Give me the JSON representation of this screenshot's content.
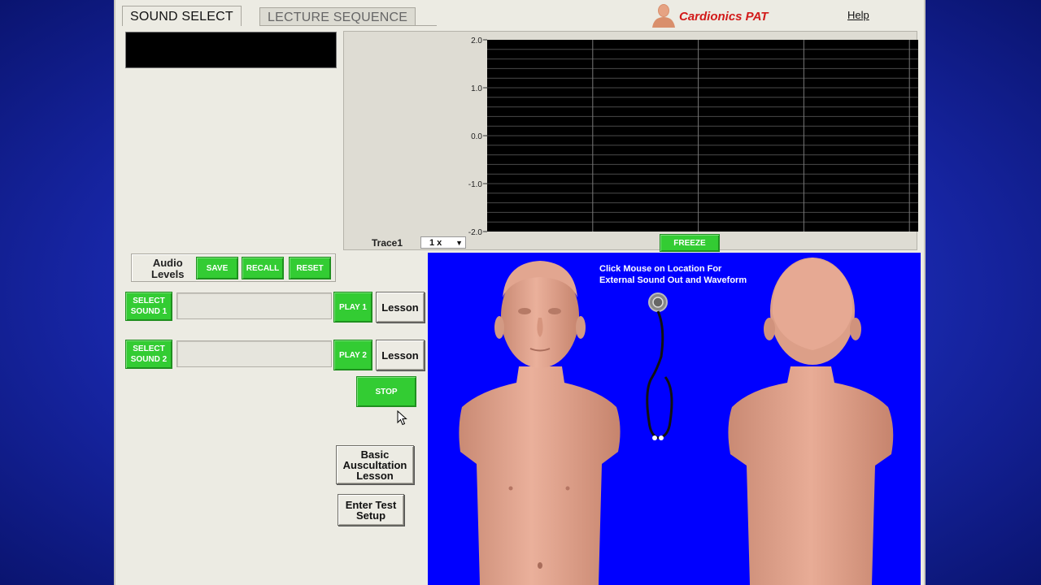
{
  "tabs": [
    {
      "label": "SOUND SELECT",
      "active": true
    },
    {
      "label": "LECTURE SEQUENCE",
      "active": false
    }
  ],
  "brand": {
    "name": "Cardionics PAT",
    "color": "#d21a1a"
  },
  "menu": {
    "help_label": "Help"
  },
  "chart_data": {
    "type": "line",
    "title": "",
    "xlabel": "",
    "ylabel": "",
    "ylim": [
      -2.0,
      2.0
    ],
    "yticks": [
      "2.0",
      "1.0",
      "0.0",
      "-1.0",
      "-2.0"
    ],
    "grid": true,
    "background": "#000000",
    "series": [
      {
        "name": "Trace1",
        "values": []
      }
    ]
  },
  "trace": {
    "label": "Trace1",
    "scale_value": "1 x"
  },
  "freeze_label": "FREEZE",
  "audio_levels": {
    "label_line1": "Audio",
    "label_line2": "Levels",
    "save_label": "SAVE",
    "recall_label": "RECALL",
    "reset_label": "RESET"
  },
  "sound1": {
    "select_line1": "SELECT",
    "select_line2": "SOUND 1",
    "value": "",
    "play_label": "PLAY 1",
    "lesson_label": "Lesson"
  },
  "sound2": {
    "select_line1": "SELECT",
    "select_line2": "SOUND 2",
    "value": "",
    "play_label": "PLAY 2",
    "lesson_label": "Lesson"
  },
  "stop_label": "STOP",
  "basic_lesson": {
    "line1": "Basic",
    "line2": "Auscultation",
    "line3": "Lesson"
  },
  "test_setup": {
    "line1": "Enter Test",
    "line2": "Setup"
  },
  "manikin": {
    "instruction_line1": "Click Mouse on Location For",
    "instruction_line2": "External Sound Out and Waveform",
    "panel_color": "#0000ff",
    "skin_color": "#e8a58f"
  },
  "colors": {
    "green_button": "#33cc33",
    "app_background": "#ecebe3"
  }
}
